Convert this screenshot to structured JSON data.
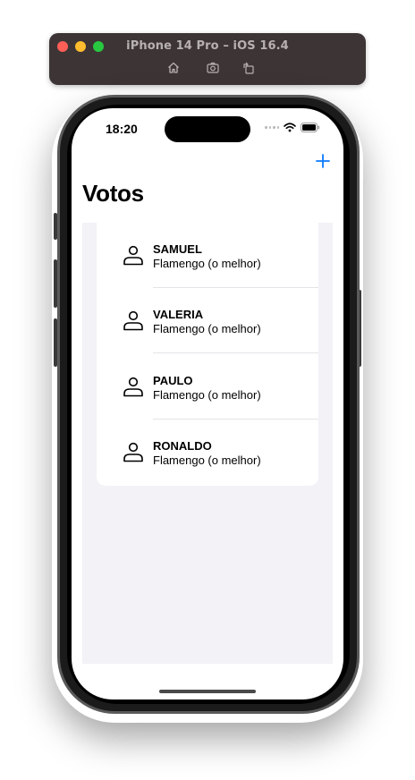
{
  "simulator": {
    "title": "iPhone 14 Pro – iOS 16.4",
    "toolbar_icons": [
      "home-icon",
      "screenshot-icon",
      "rotate-icon"
    ]
  },
  "status_bar": {
    "time": "18:20"
  },
  "nav": {
    "title": "Votos",
    "add_icon": "plus-icon",
    "accent_color": "#0a7aff"
  },
  "votes": [
    {
      "name": "SAMUEL",
      "team": "Flamengo (o melhor)",
      "icon": "person-icon"
    },
    {
      "name": "VALERIA",
      "team": "Flamengo (o melhor)",
      "icon": "person-icon"
    },
    {
      "name": "PAULO",
      "team": "Flamengo (o melhor)",
      "icon": "person-icon"
    },
    {
      "name": "RONALDO",
      "team": "Flamengo (o melhor)",
      "icon": "person-icon"
    }
  ]
}
